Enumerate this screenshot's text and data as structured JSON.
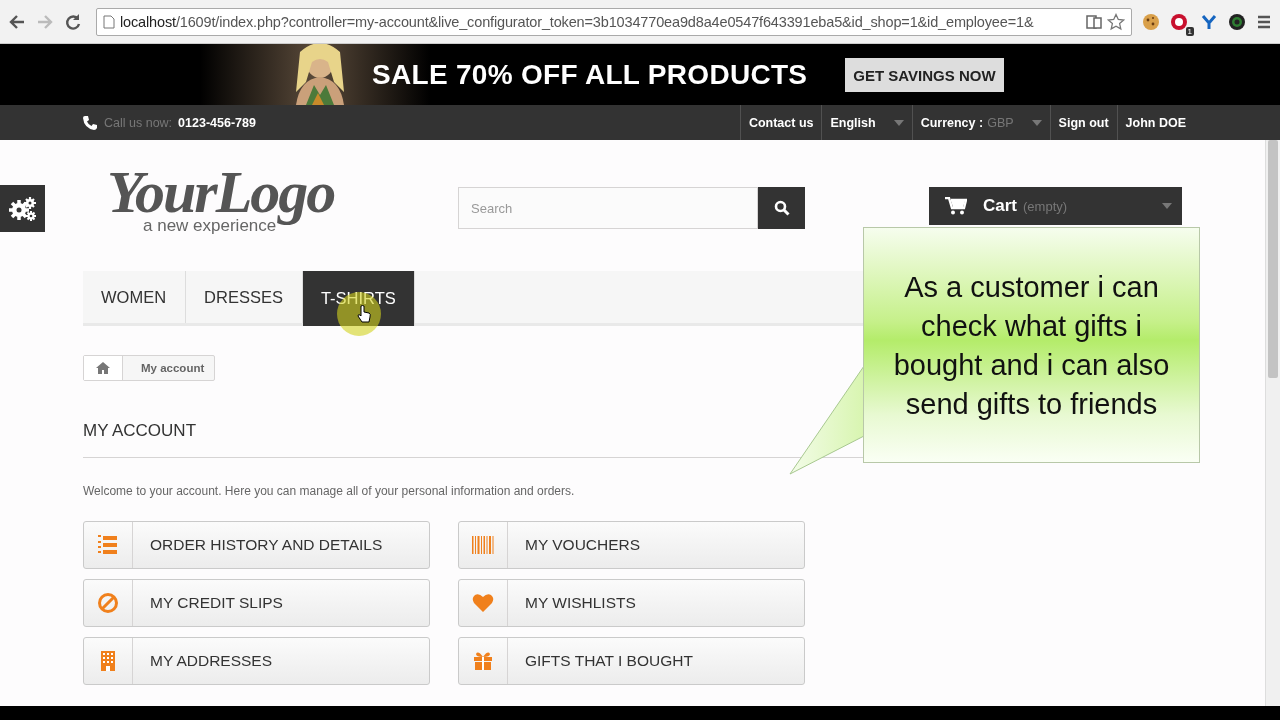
{
  "browser": {
    "url_host": "localhost",
    "url_rest": "/1609t/index.php?controller=my-account&live_configurator_token=3b1034770ea9d8a4e0547f643391eba5&id_shop=1&id_employee=1&",
    "extension_badge": "1"
  },
  "banner": {
    "headline": "SALE 70% OFF ALL PRODUCTS",
    "button": "GET SAVINGS NOW"
  },
  "nav": {
    "phone_label": "Call us now:",
    "phone": "0123-456-789",
    "links": [
      {
        "kind": "link",
        "label": "Contact us"
      },
      {
        "kind": "dropdown",
        "label": "English"
      },
      {
        "kind": "dropdown",
        "label": "Currency :",
        "value": "GBP"
      },
      {
        "kind": "link",
        "label": "Sign out"
      },
      {
        "kind": "link",
        "label": "John DOE"
      }
    ]
  },
  "logo": {
    "name": "YourLogo",
    "tagline": "a new experience"
  },
  "search": {
    "placeholder": "Search"
  },
  "cart": {
    "label": "Cart",
    "status": "(empty)"
  },
  "menu": [
    {
      "label": "WOMEN",
      "selected": false
    },
    {
      "label": "DRESSES",
      "selected": false
    },
    {
      "label": "T-SHIRTS",
      "selected": true
    }
  ],
  "breadcrumb": {
    "current": "My account"
  },
  "title": "MY ACCOUNT",
  "intro": "Welcome to your account. Here you can manage all of your personal information and orders.",
  "left_links": [
    {
      "kind": "orders",
      "label": "ORDER HISTORY AND DETAILS"
    },
    {
      "kind": "slips",
      "label": "MY CREDIT SLIPS"
    },
    {
      "kind": "addresses",
      "label": "MY ADDRESSES"
    }
  ],
  "right_links": [
    {
      "kind": "vouchers",
      "label": "MY VOUCHERS"
    },
    {
      "kind": "wishlists",
      "label": "MY WISHLISTS"
    },
    {
      "kind": "gifts",
      "label": "GIFTS THAT I BOUGHT"
    }
  ],
  "callout": "As a customer i can check what gifts i bought and i can also send gifts to friends"
}
